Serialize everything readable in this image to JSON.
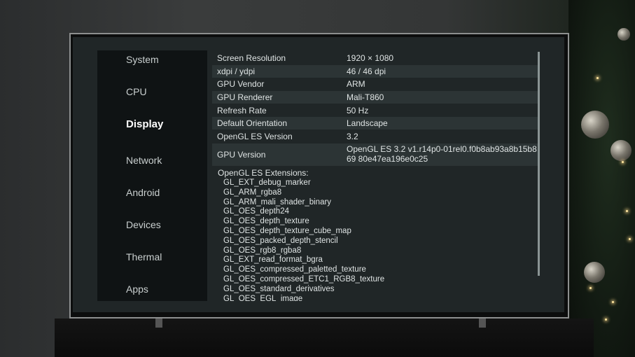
{
  "sidebar": {
    "items": [
      {
        "label": "System"
      },
      {
        "label": "CPU"
      },
      {
        "label": "Display",
        "active": true
      },
      {
        "label": "Network"
      },
      {
        "label": "Android"
      },
      {
        "label": "Devices"
      },
      {
        "label": "Thermal"
      },
      {
        "label": "Apps"
      }
    ]
  },
  "display": {
    "rows": [
      {
        "key": "Screen Resolution",
        "value": "1920 × 1080"
      },
      {
        "key": "xdpi / ydpi",
        "value": "46 / 46 dpi"
      },
      {
        "key": "GPU Vendor",
        "value": "ARM"
      },
      {
        "key": "GPU Renderer",
        "value": "Mali-T860"
      },
      {
        "key": "Refresh Rate",
        "value": "50 Hz"
      },
      {
        "key": "Default Orientation",
        "value": "Landscape"
      },
      {
        "key": "OpenGL ES Version",
        "value": "3.2"
      },
      {
        "key": "GPU Version",
        "value": "OpenGL ES 3.2 v1.r14p0-01rel0.f0b8ab93a8b15b869 80e47ea196e0c25"
      }
    ],
    "extensions_title": "OpenGL ES Extensions:",
    "extensions": [
      "GL_EXT_debug_marker",
      "GL_ARM_rgba8",
      "GL_ARM_mali_shader_binary",
      "GL_OES_depth24",
      "GL_OES_depth_texture",
      "GL_OES_depth_texture_cube_map",
      "GL_OES_packed_depth_stencil",
      "GL_OES_rgb8_rgba8",
      "GL_EXT_read_format_bgra",
      "GL_OES_compressed_paletted_texture",
      "GL_OES_compressed_ETC1_RGB8_texture",
      "GL_OES_standard_derivatives",
      "GL_OES_EGL_image"
    ]
  }
}
